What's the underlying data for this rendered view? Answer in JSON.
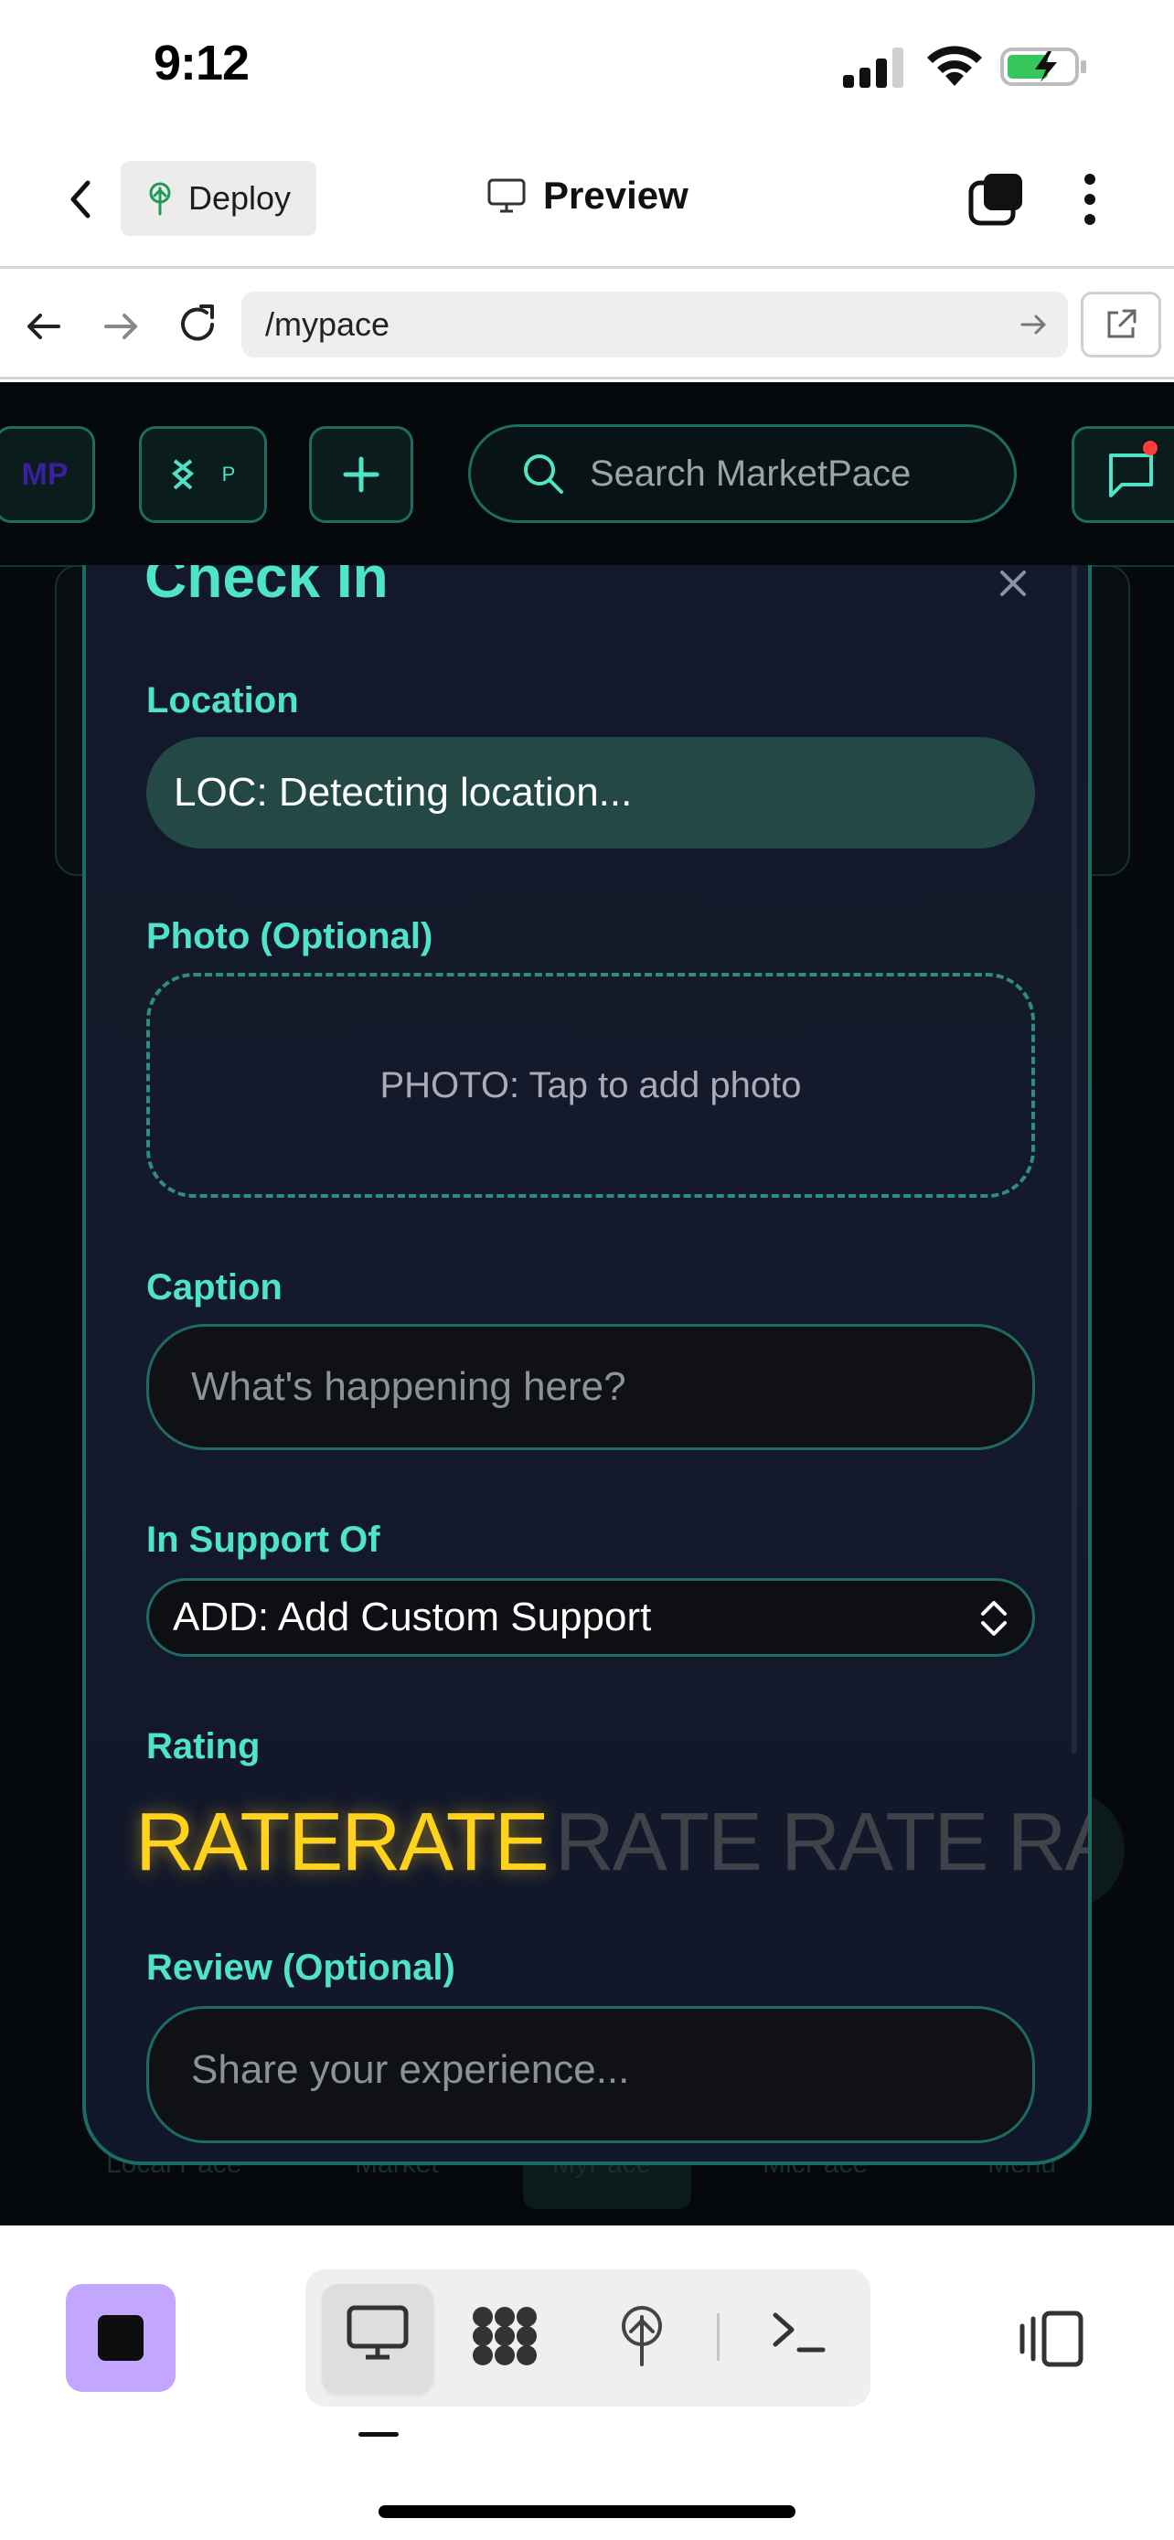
{
  "status_bar": {
    "time": "9:12"
  },
  "toolbar": {
    "deploy_label": "Deploy",
    "preview_label": "Preview"
  },
  "url_bar": {
    "url": "/mypace"
  },
  "app_nav": {
    "mp_label": "MP",
    "logo_sub": "P",
    "search_placeholder": "Search MarketPace"
  },
  "bottom_nav": {
    "items": [
      "Local Pace",
      "Market",
      "MyPace",
      "MicPace",
      "Menu"
    ]
  },
  "modal": {
    "title": "Check In",
    "location_label": "Location",
    "location_value": "LOC: Detecting location...",
    "photo_label": "Photo (Optional)",
    "photo_prompt": "PHOTO: Tap to add photo",
    "caption_label": "Caption",
    "caption_placeholder": "What's happening here?",
    "support_label": "In Support Of",
    "support_value": "ADD: Add Custom Support",
    "rating_label": "Rating",
    "rating_items": [
      "RATE",
      "RATE",
      "RATE",
      "RATE",
      "RATE"
    ],
    "rating_selected": 2,
    "review_label": "Review (Optional)",
    "review_placeholder": "Share your experience..."
  },
  "colors": {
    "accent": "#4fe3c8",
    "rating_active": "#ffd21e",
    "stop_button": "#c3a6ff",
    "notification_dot": "#ff3b3b"
  },
  "icons": [
    "chevron-left-icon",
    "deploy-icon",
    "monitor-icon",
    "tabs-icon",
    "more-vertical-icon",
    "back-arrow-icon",
    "forward-arrow-icon",
    "reload-icon",
    "go-arrow-icon",
    "external-link-icon",
    "logo-icon",
    "plus-icon",
    "search-icon",
    "chat-icon",
    "close-icon",
    "select-chevron-icon",
    "stop-icon",
    "preview-tab-icon",
    "workflows-icon",
    "deployments-icon",
    "shell-icon",
    "panel-toggle-icon"
  ]
}
